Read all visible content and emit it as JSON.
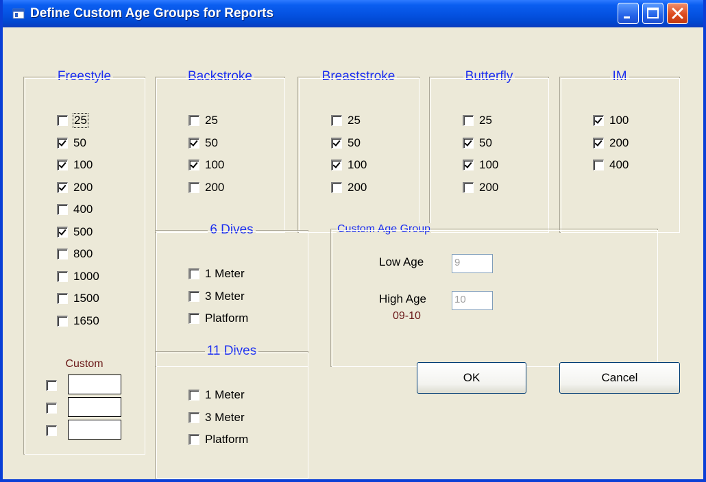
{
  "window": {
    "title": "Define Custom Age Groups for Reports"
  },
  "groups": {
    "freestyle": {
      "label": "Freestyle",
      "items": [
        {
          "label": "25",
          "checked": false
        },
        {
          "label": "50",
          "checked": true
        },
        {
          "label": "100",
          "checked": true
        },
        {
          "label": "200",
          "checked": true
        },
        {
          "label": "400",
          "checked": false
        },
        {
          "label": "500",
          "checked": true
        },
        {
          "label": "800",
          "checked": false
        },
        {
          "label": "1000",
          "checked": false
        },
        {
          "label": "1500",
          "checked": false
        },
        {
          "label": "1650",
          "checked": false
        }
      ],
      "custom_label": "Custom"
    },
    "backstroke": {
      "label": "Backstroke",
      "items": [
        {
          "label": "25",
          "checked": false
        },
        {
          "label": "50",
          "checked": true
        },
        {
          "label": "100",
          "checked": true
        },
        {
          "label": "200",
          "checked": false
        }
      ]
    },
    "breaststroke": {
      "label": "Breaststroke",
      "items": [
        {
          "label": "25",
          "checked": false
        },
        {
          "label": "50",
          "checked": true
        },
        {
          "label": "100",
          "checked": true
        },
        {
          "label": "200",
          "checked": false
        }
      ]
    },
    "butterfly": {
      "label": "Butterfly",
      "items": [
        {
          "label": "25",
          "checked": false
        },
        {
          "label": "50",
          "checked": true
        },
        {
          "label": "100",
          "checked": true
        },
        {
          "label": "200",
          "checked": false
        }
      ]
    },
    "im": {
      "label": "IM",
      "items": [
        {
          "label": "100",
          "checked": true
        },
        {
          "label": "200",
          "checked": true
        },
        {
          "label": "400",
          "checked": false
        }
      ]
    },
    "six_dives": {
      "label": "6 Dives",
      "items": [
        {
          "label": "1 Meter",
          "checked": false
        },
        {
          "label": "3 Meter",
          "checked": false
        },
        {
          "label": "Platform",
          "checked": false
        }
      ]
    },
    "eleven_dives": {
      "label": "11 Dives",
      "items": [
        {
          "label": "1 Meter",
          "checked": false
        },
        {
          "label": "3 Meter",
          "checked": false
        },
        {
          "label": "Platform",
          "checked": false
        }
      ]
    },
    "custom_age_group": {
      "label": "Custom Age Group",
      "low_age_label": "Low Age",
      "low_age_value": "9",
      "high_age_label": "High Age",
      "high_age_value": "10",
      "range_text": "09-10"
    }
  },
  "buttons": {
    "ok": "OK",
    "cancel": "Cancel"
  },
  "colors": {
    "title_bar": "#0553e3",
    "legend": "#1c2ff0",
    "range_text": "#6a1818"
  }
}
